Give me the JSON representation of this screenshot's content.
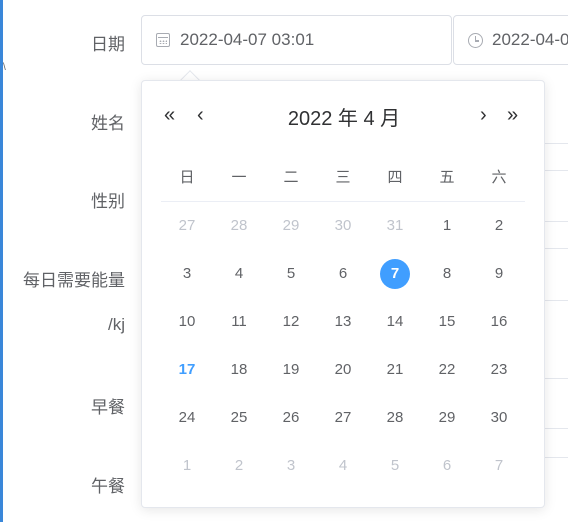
{
  "form": {
    "labels": [
      "日期",
      "姓名",
      "性别",
      "每日需要能量",
      "/kj",
      "早餐",
      "午餐"
    ],
    "date_value": "2022-04-07 03:01",
    "time_value": "2022-04-0"
  },
  "calendar": {
    "nav": {
      "prev_year": "«",
      "prev_month": "‹",
      "next_month": "›",
      "next_year": "»"
    },
    "title": "2022 年  4 月",
    "weekdays": [
      "日",
      "一",
      "二",
      "三",
      "四",
      "五",
      "六"
    ],
    "weeks": [
      [
        "27",
        "28",
        "29",
        "30",
        "31",
        "1",
        "2"
      ],
      [
        "3",
        "4",
        "5",
        "6",
        "7",
        "8",
        "9"
      ],
      [
        "10",
        "11",
        "12",
        "13",
        "14",
        "15",
        "16"
      ],
      [
        "17",
        "18",
        "19",
        "20",
        "21",
        "22",
        "23"
      ],
      [
        "24",
        "25",
        "26",
        "27",
        "28",
        "29",
        "30"
      ],
      [
        "1",
        "2",
        "3",
        "4",
        "5",
        "6",
        "7"
      ]
    ],
    "selected_day": "7",
    "today_day": "17",
    "colors": {
      "accent": "#409eff",
      "text": "#606266",
      "muted": "#c0c4cc",
      "title": "#303133"
    }
  }
}
